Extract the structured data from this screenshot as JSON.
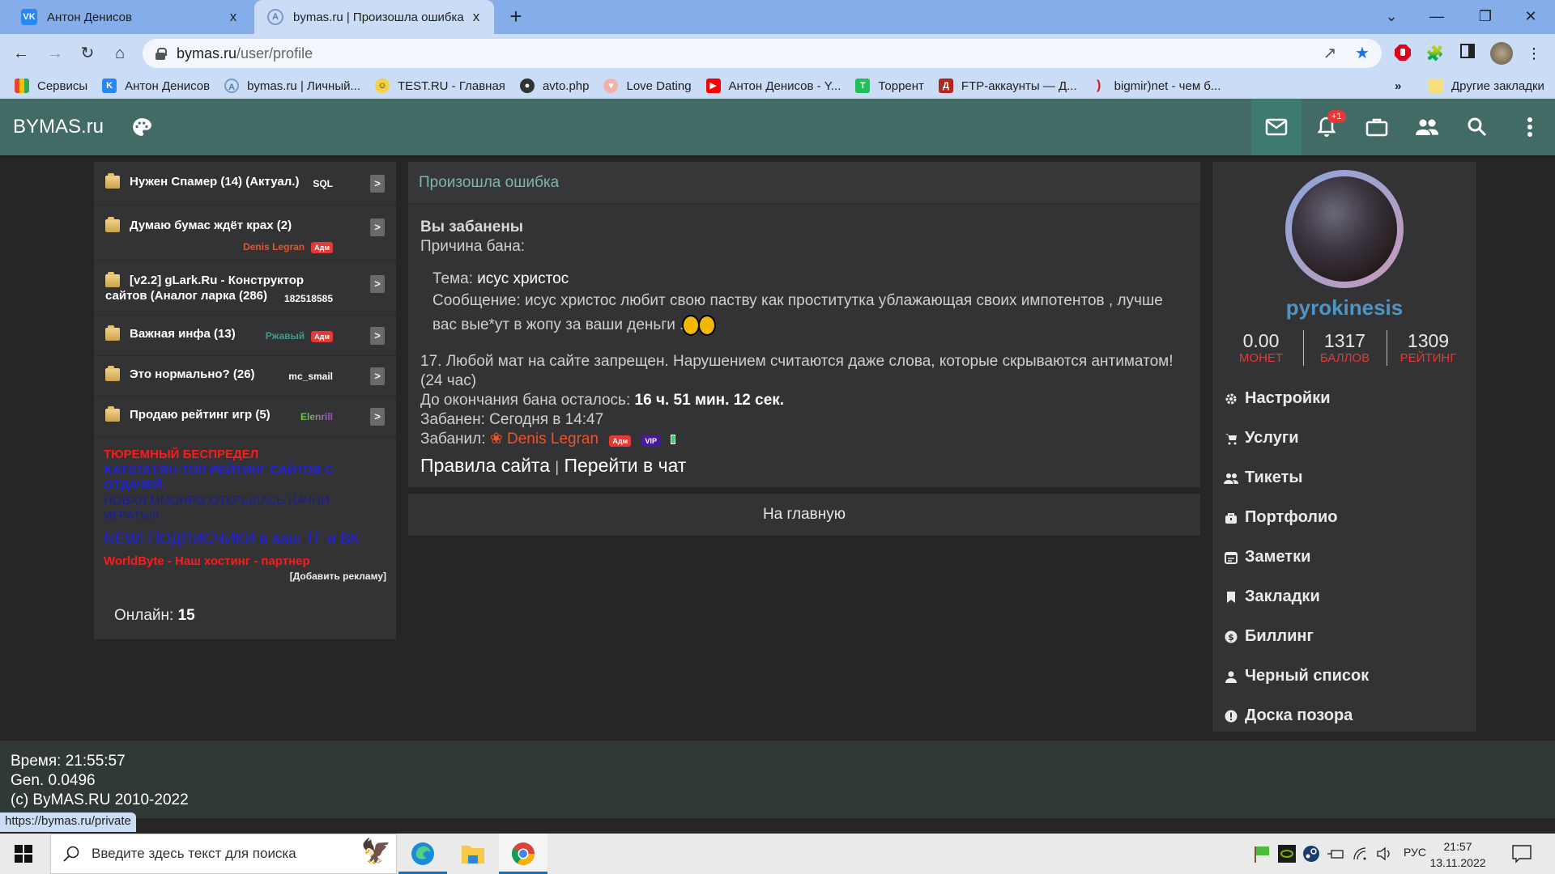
{
  "browser": {
    "tabs": [
      {
        "title": "Антон Денисов",
        "icon": "vk-icon",
        "active": false
      },
      {
        "title": "bymas.ru | Произошла ошибка",
        "icon": "bymas-icon",
        "active": true
      }
    ],
    "close_glyph": "x",
    "new_tab_glyph": "+",
    "url_host": "bymas.ru",
    "url_path": "/user/profile",
    "bookmarks": [
      {
        "label": "Сервисы",
        "icon": "apps-grid-icon"
      },
      {
        "label": "Антон Денисов",
        "icon": "vk-icon"
      },
      {
        "label": "bymas.ru | Личный...",
        "icon": "bymas-icon"
      },
      {
        "label": "TEST.RU - Главная",
        "icon": "emoji-icon"
      },
      {
        "label": "avto.php",
        "icon": "globe-icon"
      },
      {
        "label": "Love Dating",
        "icon": "dating-icon"
      },
      {
        "label": "Антон Денисов - Y...",
        "icon": "youtube-icon"
      },
      {
        "label": "Торрент",
        "icon": "torrent-icon"
      },
      {
        "label": "FTP-аккаунты — Д...",
        "icon": "ftp-icon"
      },
      {
        "label": "bigmir)net - чем б...",
        "icon": "bigmir-icon"
      }
    ],
    "more_bookmarks_glyph": "»",
    "other_bookmarks": "Другие закладки",
    "status_url": "https://bymas.ru/private"
  },
  "site": {
    "logo": "BYMAS.ru",
    "notification_badge": "+1",
    "accent": "#436b66"
  },
  "topics": [
    {
      "title": "Нужен Спамер (14) (Актуал.)",
      "author": "SQL",
      "author_color": "#ffffff",
      "badge": null
    },
    {
      "title": "Думаю бумас ждёт крах (2)",
      "author": "Denis Legran",
      "author_color": "#e8542c",
      "badge": "Адм"
    },
    {
      "title": "[v2.2] gLark.Ru - Конструктор",
      "title2": "сайтов (Аналог ларка (286)",
      "author": "182518585",
      "author_color": "#ffffff",
      "badge": null
    },
    {
      "title": "Важная инфа (13)",
      "author": "Ржавый",
      "author_color": "#3f9a8e",
      "badge": "Адм"
    },
    {
      "title": "Это нормально? (26)",
      "author": "mc_smail",
      "author_color": "#ffffff",
      "badge": null
    },
    {
      "title": "Продаю рейтинг игр (5)",
      "author": "Elenrill",
      "author_color": "#6ad13a",
      "badge": null
    }
  ],
  "topic_go_glyph": ">",
  "ads": {
    "ad1": "ТЮРЕМНЫЙ БЕСПРЕДЕЛ",
    "ad2": "KATSTAT.RU-ТОП РЕЙТИНГ САЙТОВ С ОТДАЧЕЙ",
    "ad3": "НОВАЯ MMORPG ОТКРЫЛАСЬ НАЧНИ ИГРАТЬ!!!",
    "ad4": "NEW! ПОДПИСЧИКИ в ваш ТГ и ВК",
    "ad5": "WorldByte - Наш хостинг - партнер",
    "add_ad": "[Добавить рекламу]"
  },
  "online": {
    "label": "Онлайн:",
    "count": "15"
  },
  "error_panel": {
    "title": "Произошла ошибка",
    "banned": "Вы забанены",
    "reason_label": "Причина бана:",
    "topic_label": "Тема:",
    "topic_value": "исус христос",
    "message_label": "Сообщение:",
    "message_value": "исус христос любит свою паству как проститутка ублажающая своих импотентов , лучше вас вые*ут в жопу за ваши деньги .",
    "rule": "17. Любой мат на сайте запрещен. Нарушением считаются даже слова, которые скрываются антиматом! (24 час)",
    "remaining_label": "До окончания бана осталось:",
    "remaining_value": "16 ч. 51 мин. 12 сек.",
    "banned_at": "Забанен: Сегодня в 14:47",
    "banned_by_label": "Забанил:",
    "banned_by": "Denis Legran",
    "adm_badge": "Адм",
    "vip_badge": "VIP",
    "rules_link": "Правила сайта",
    "separator": "|",
    "chat_link": "Перейти в чат"
  },
  "home_button": "На главную",
  "profile": {
    "username": "pyrokinesis",
    "stats": [
      {
        "value": "0.00",
        "label": "МОНЕТ"
      },
      {
        "value": "1317",
        "label": "БАЛЛОВ"
      },
      {
        "value": "1309",
        "label": "РЕЙТИНГ"
      }
    ],
    "menu": [
      {
        "label": "Настройки",
        "icon": "gear-icon"
      },
      {
        "label": "Услуги",
        "icon": "cart-icon"
      },
      {
        "label": "Тикеты",
        "icon": "people-icon"
      },
      {
        "label": "Портфолио",
        "icon": "briefcase-lock-icon"
      },
      {
        "label": "Заметки",
        "icon": "notes-icon"
      },
      {
        "label": "Закладки",
        "icon": "bookmark-icon"
      },
      {
        "label": "Биллинг",
        "icon": "dollar-icon"
      },
      {
        "label": "Черный список",
        "icon": "person-icon"
      },
      {
        "label": "Доска позора",
        "icon": "alert-icon"
      }
    ]
  },
  "footer": {
    "time": "Время: 21:55:57",
    "gen": "Gen. 0.0496",
    "copyright": "(c) ByMAS.RU 2010-2022"
  },
  "taskbar": {
    "search_placeholder": "Введите здесь текст для поиска",
    "lang": "РУС",
    "time": "21:57",
    "date": "13.11.2022"
  }
}
